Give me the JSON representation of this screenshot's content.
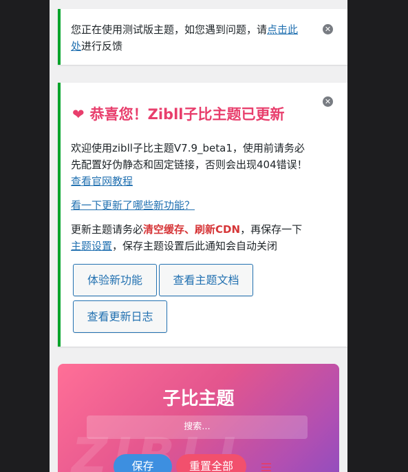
{
  "notice_beta": {
    "text_before": "您正在使用测试版主题，如您遇到问题，请",
    "link": "点击此处",
    "text_after": "进行反馈"
  },
  "notice_update": {
    "heading": "恭喜您！Zibll子比主题已更新",
    "p1_text": "欢迎使用zibll子比主题V7.9_beta1，使用前请务必先配置好伪静态和固定链接，否则会出现404错误！",
    "p1_link": "查看官网教程",
    "p2_link": "看一下更新了哪些新功能？",
    "p3_a": "更新主题请务必",
    "p3_hl1": "清空缓存",
    "p3_sep": "、",
    "p3_hl2": "刷新CDN",
    "p3_b": "，再保存一下",
    "p3_link": "主题设置",
    "p3_c": "，保存主题设置后此通知会自动关闭",
    "buttons": [
      "体验新功能",
      "查看主题文档",
      "查看更新日志"
    ]
  },
  "hero": {
    "title": "子比主题",
    "search_placeholder": "搜索...",
    "save_label": "保存",
    "reset_label": "重置全部",
    "watermark": "ZIBLL"
  }
}
